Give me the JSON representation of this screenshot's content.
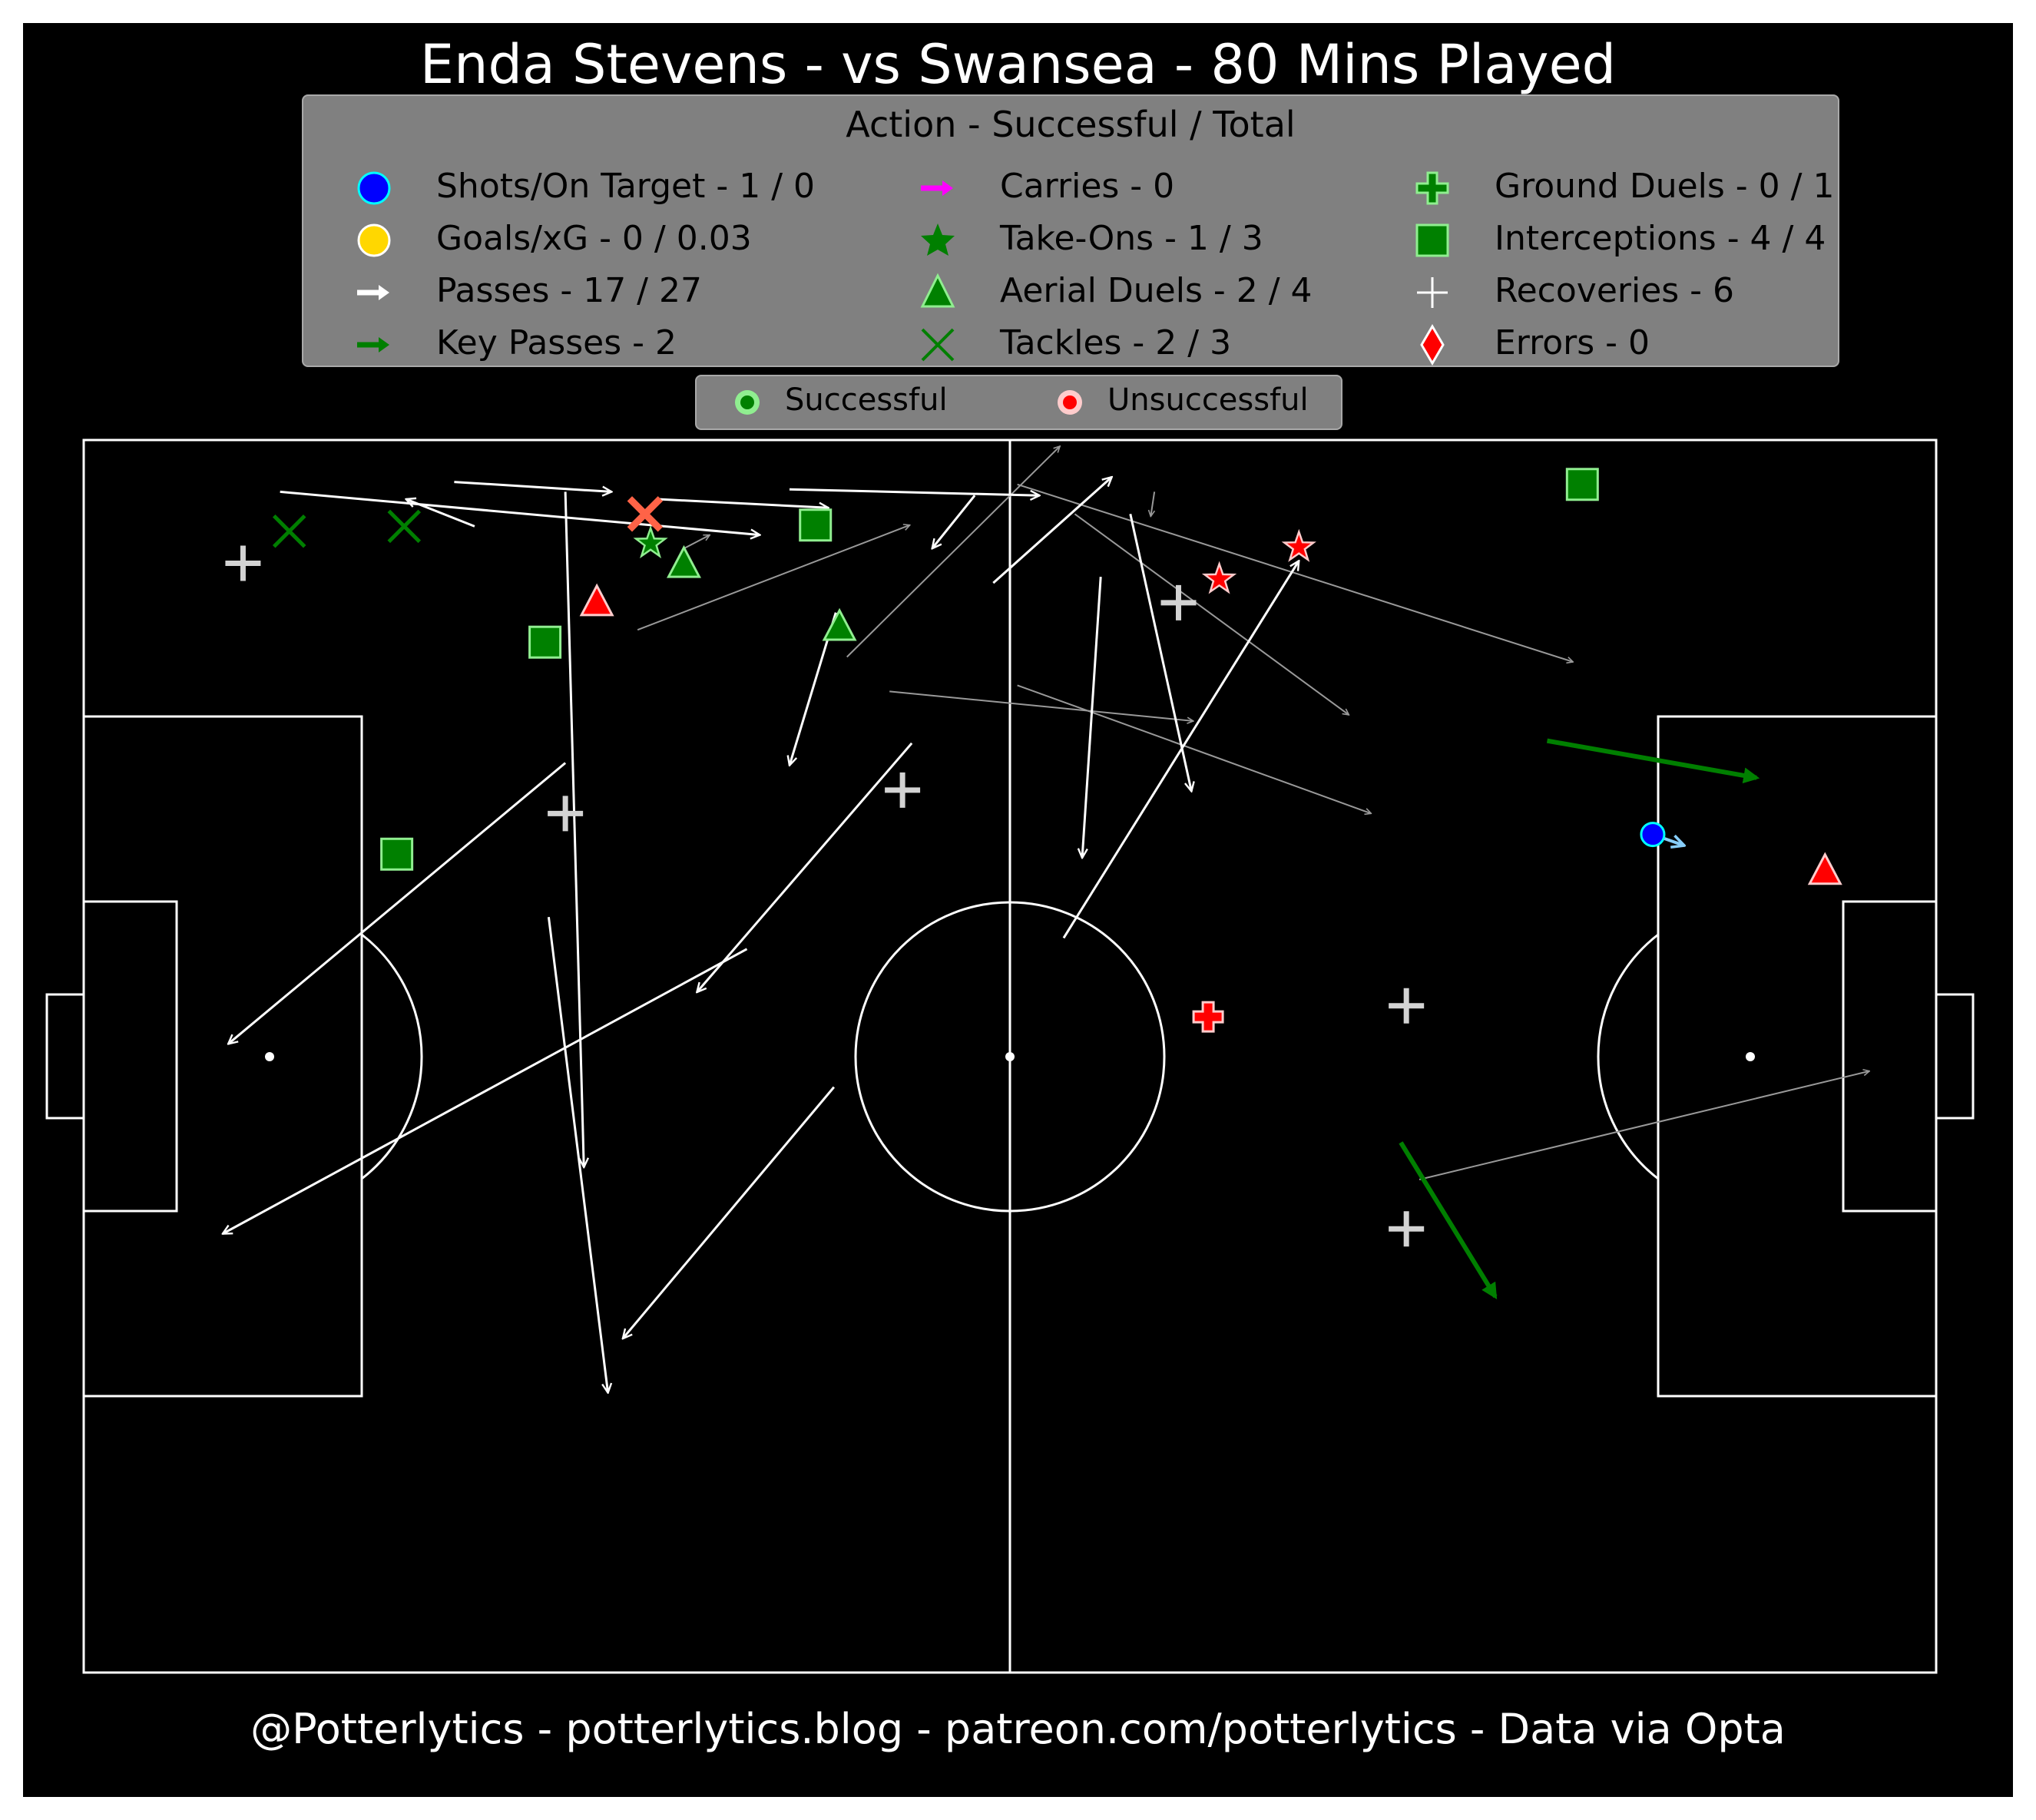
{
  "title": "Enda Stevens - vs Swansea - 80 Mins Played",
  "footer": "@Potterlytics - potterlytics.blog - patreon.com/potterlytics - Data via Opta",
  "legend": {
    "title": "Action - Successful / Total",
    "items": [
      {
        "key": "shots",
        "label": "Shots/On Target - 1 / 0",
        "icon": "blue-circle-icon",
        "color": "#0000ff"
      },
      {
        "key": "goals",
        "label": "Goals/xG - 0 / 0.03",
        "icon": "gold-circle-icon",
        "color": "#ffd700"
      },
      {
        "key": "passes",
        "label": "Passes - 17 / 27",
        "icon": "white-arrow-icon",
        "color": "#ffffff"
      },
      {
        "key": "key_passes",
        "label": "Key Passes - 2",
        "icon": "green-arrow-icon",
        "color": "#007f00"
      },
      {
        "key": "carries",
        "label": "Carries - 0",
        "icon": "magenta-arrow-icon",
        "color": "#ff00ff"
      },
      {
        "key": "take_ons",
        "label": "Take-Ons - 1 / 3",
        "icon": "star-icon",
        "color": "#007f00"
      },
      {
        "key": "aerial_duels",
        "label": "Aerial Duels - 2 / 4",
        "icon": "triangle-icon",
        "color": "#008000"
      },
      {
        "key": "tackles",
        "label": "Tackles - 2 / 3",
        "icon": "x-icon",
        "color": "#007f00"
      },
      {
        "key": "ground_duels",
        "label": "Ground Duels - 0 / 1",
        "icon": "plus-icon",
        "color": "#008000"
      },
      {
        "key": "interceptions",
        "label": "Interceptions - 4 / 4",
        "icon": "square-icon",
        "color": "#008000"
      },
      {
        "key": "recoveries",
        "label": "Recoveries - 6",
        "icon": "thin-plus-icon",
        "color": "#ffffff"
      },
      {
        "key": "errors",
        "label": "Errors - 0",
        "icon": "diamond-icon",
        "color": "#ff0000"
      }
    ]
  },
  "result_legend": {
    "successful": "Successful",
    "unsuccessful": "Unsuccessful",
    "successful_color": "#008000",
    "unsuccessful_color": "#ff0000"
  },
  "chart_data": {
    "type": "scatter",
    "pitch": {
      "length": 100,
      "width": 100,
      "direction": "attacking left to right",
      "y_origin": "top edge"
    },
    "passes_successful": [
      [
        10.6,
        4.2,
        36.5,
        7.7
      ],
      [
        44.7,
        24.6,
        33.1,
        44.8
      ],
      [
        48.1,
        4.5,
        45.8,
        8.8
      ],
      [
        40.5,
        52.5,
        29.1,
        72.9
      ],
      [
        38.1,
        4.0,
        51.6,
        4.5
      ],
      [
        49.1,
        11.6,
        55.5,
        3.0
      ],
      [
        31.0,
        4.8,
        40.2,
        5.5
      ],
      [
        26.0,
        26.2,
        7.8,
        49.0
      ],
      [
        21.1,
        7.0,
        17.4,
        4.8
      ],
      [
        35.8,
        41.3,
        7.5,
        64.4
      ],
      [
        25.1,
        38.7,
        28.3,
        77.3
      ],
      [
        52.9,
        40.4,
        65.6,
        9.8
      ],
      [
        26.0,
        4.2,
        27.0,
        59.0
      ],
      [
        40.6,
        14.0,
        38.1,
        26.4
      ],
      [
        20.0,
        3.4,
        28.5,
        4.2
      ],
      [
        56.5,
        6.0,
        59.8,
        28.5
      ],
      [
        54.9,
        11.1,
        53.9,
        33.9
      ]
    ],
    "passes_unsuccessful": [
      [
        41.2,
        17.6,
        52.7,
        0.5
      ],
      [
        29.9,
        15.4,
        44.6,
        6.9
      ],
      [
        50.4,
        3.6,
        80.4,
        18.0
      ],
      [
        53.5,
        6.0,
        68.3,
        22.3
      ],
      [
        43.5,
        20.4,
        59.9,
        22.8
      ],
      [
        50.4,
        19.9,
        69.5,
        30.3
      ],
      [
        32.4,
        8.8,
        33.8,
        7.7
      ],
      [
        57.8,
        4.2,
        57.6,
        6.2
      ],
      [
        72.1,
        60.0,
        96.4,
        51.2
      ]
    ],
    "key_passes": [
      [
        79.0,
        24.4,
        90.3,
        27.4
      ],
      [
        71.1,
        57.0,
        76.2,
        69.5
      ]
    ],
    "shots": [
      {
        "x": 84.7,
        "y": 32.0,
        "x_end": 86.4,
        "y_end": 32.9,
        "on_target": false,
        "xG": 0.03
      }
    ],
    "take_ons": [
      {
        "x": 30.6,
        "y": 8.4,
        "successful": true
      },
      {
        "x": 61.3,
        "y": 11.3,
        "successful": false
      },
      {
        "x": 65.6,
        "y": 8.7,
        "successful": false
      }
    ],
    "aerial_duels": [
      {
        "x": 40.8,
        "y": 15.2,
        "successful": true
      },
      {
        "x": 32.4,
        "y": 10.1,
        "successful": true
      },
      {
        "x": 27.7,
        "y": 13.2,
        "successful": false
      },
      {
        "x": 94.0,
        "y": 35.0,
        "successful": false
      }
    ],
    "tackles": [
      {
        "x": 11.1,
        "y": 7.4,
        "successful": true
      },
      {
        "x": 17.3,
        "y": 7.0,
        "successful": true
      },
      {
        "x": 30.3,
        "y": 6.0,
        "successful": false
      }
    ],
    "ground_duels": [
      {
        "x": 60.7,
        "y": 46.8,
        "successful": false
      }
    ],
    "interceptions": [
      {
        "x": 80.9,
        "y": 3.6
      },
      {
        "x": 39.5,
        "y": 6.9
      },
      {
        "x": 24.9,
        "y": 16.4
      },
      {
        "x": 16.9,
        "y": 33.6
      }
    ],
    "recoveries": [
      {
        "x": 8.6,
        "y": 10.0
      },
      {
        "x": 26.0,
        "y": 30.3
      },
      {
        "x": 44.2,
        "y": 28.4
      },
      {
        "x": 59.1,
        "y": 13.2
      },
      {
        "x": 71.4,
        "y": 45.9
      },
      {
        "x": 71.4,
        "y": 64.0
      }
    ]
  }
}
